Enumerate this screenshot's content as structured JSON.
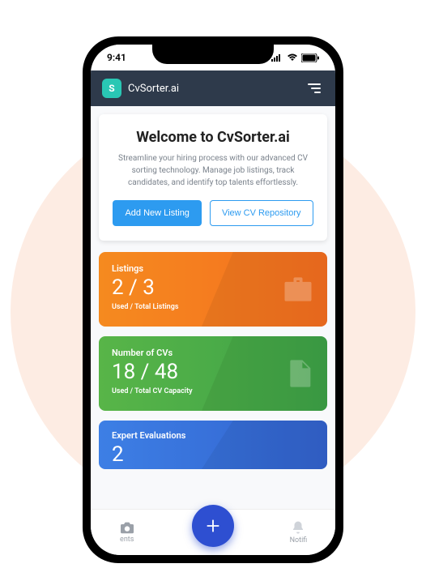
{
  "statusbar": {
    "time": "9:41"
  },
  "header": {
    "logo_letter": "S",
    "app_name": "CvSorter.ai"
  },
  "welcome": {
    "title": "Welcome to CvSorter.ai",
    "description": "Streamline your hiring process with our advanced CV sorting technology. Manage job listings, track candidates, and identify top talents effortlessly.",
    "primary_button": "Add New Listing",
    "secondary_button": "View CV Repository"
  },
  "cards": {
    "listings": {
      "label": "Listings",
      "value": "2 / 3",
      "note": "Used / Total Listings"
    },
    "cvs": {
      "label": "Number of CVs",
      "value": "18 / 48",
      "note": "Used / Total CV Capacity"
    },
    "evaluations": {
      "label": "Expert Evaluations",
      "value": "2"
    }
  },
  "nav": {
    "item1_partial": "ents",
    "item2_partial": "Notifi"
  },
  "colors": {
    "accent": "#2d9bf0",
    "header_bg": "#2e3a4b",
    "logo_bg": "#29c7b4",
    "fab_bg": "#2e4fd1"
  }
}
